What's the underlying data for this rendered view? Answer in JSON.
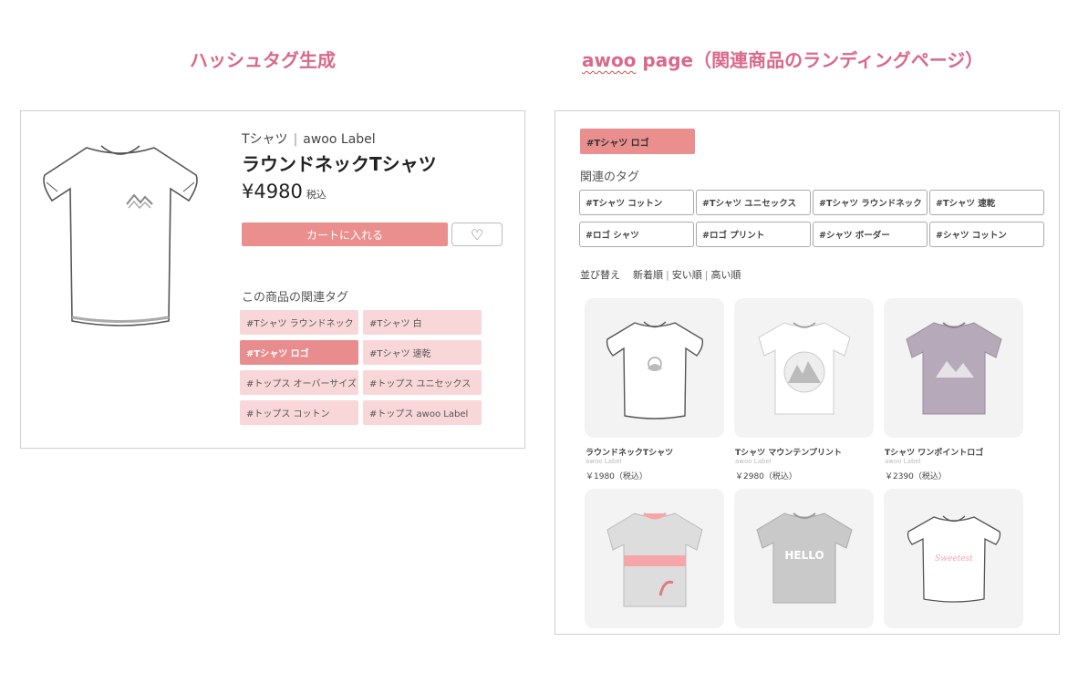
{
  "headings": {
    "left": "ハッシュタグ生成",
    "right_prefix": "awoo",
    "right_rest": " page（関連商品のランディングページ）"
  },
  "product": {
    "category": "Tシャツ",
    "separator": "|",
    "brand": "awoo Label",
    "name": "ラウンドネックTシャツ",
    "price": "¥4980",
    "tax_label": "税込",
    "cart_button": "カートに入れる",
    "favorite_icon": "heart-icon",
    "related_tags_label": "この商品の関連タグ",
    "tags": [
      {
        "label": "#Tシャツ ラウンドネック",
        "active": false
      },
      {
        "label": "#Tシャツ 白",
        "active": false
      },
      {
        "label": "#Tシャツ ロゴ",
        "active": true
      },
      {
        "label": "#Tシャツ 速乾",
        "active": false
      },
      {
        "label": "#トップス オーバーサイズ",
        "active": false
      },
      {
        "label": "#トップス ユニセックス",
        "active": false
      },
      {
        "label": "#トップス コットン",
        "active": false
      },
      {
        "label": "#トップス awoo Label",
        "active": false
      }
    ]
  },
  "landing": {
    "active_tag": "#Tシャツ ロゴ",
    "related_tags_label": "関連のタグ",
    "related_tags": [
      "#Tシャツ コットン",
      "#Tシャツ ユニセックス",
      "#Tシャツ ラウンドネック",
      "#Tシャツ 速乾",
      "#ロゴ シャツ",
      "#ロゴ プリント",
      "#シャツ ボーダー",
      "#シャツ コットン"
    ],
    "sort": {
      "label": "並び替え",
      "options": [
        "新着順",
        "安い順",
        "高い順"
      ],
      "divider": "|"
    },
    "products": [
      {
        "name": "ラウンドネックTシャツ",
        "brand": "awoo Label",
        "price": "￥1980（税込）"
      },
      {
        "name": "Tシャツ マウンテンプリント",
        "brand": "awoo Label",
        "price": "￥2980（税込）"
      },
      {
        "name": "Tシャツ ワンポイントロゴ",
        "brand": "awoo Label",
        "price": "￥2390（税込）"
      },
      {
        "name": "",
        "brand": "",
        "price": ""
      },
      {
        "name": "",
        "brand": "",
        "price": ""
      },
      {
        "name": "",
        "brand": "",
        "price": ""
      }
    ],
    "shirt_prints": {
      "hello_text": "HELLO",
      "script_text": "Sweetest"
    }
  },
  "colors": {
    "heading": "#d9698a",
    "tag_bg": "#f9d7d8",
    "tag_active": "#e98c8d",
    "cart_button": "#ea8e8e"
  }
}
